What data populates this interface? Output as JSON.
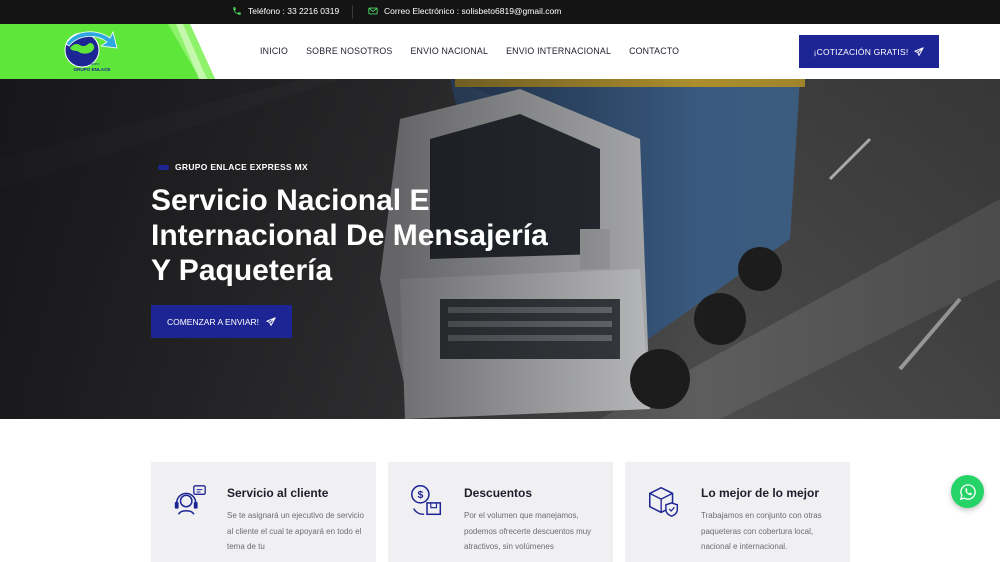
{
  "topbar": {
    "phone": "Teléfono : 33 2216 0319",
    "email": "Correo Electrónico : solisbeto6819@gmail.com"
  },
  "logo": {
    "text_top": "GRUPO",
    "text_bottom": "GRUPO ENLACE"
  },
  "nav": {
    "items": [
      "INICIO",
      "SOBRE NOSOTROS",
      "ENVIO NACIONAL",
      "ENVIO INTERNACIONAL",
      "CONTACTO"
    ],
    "quote_button": "¡COTIZACIÓN GRATIS!"
  },
  "hero": {
    "eyebrow": "GRUPO ENLACE EXPRESS MX",
    "title": "Servicio Nacional E Internacional De Mensajería Y Paquetería",
    "cta": "COMENZAR A ENVIAR!"
  },
  "cards": [
    {
      "title": "Servicio al cliente",
      "text": "Se te asignará un ejecutivo de servicio al cliente el cual te apoyará en todo el tema de tu"
    },
    {
      "title": "Descuentos",
      "text": "Por el volumen que manejamos, podemos ofrecerte descuentos muy atractivos, sin volúmenes"
    },
    {
      "title": "Lo mejor de lo mejor",
      "text": "Trabajamos en conjunto con otras paqueteras con cobertura local, nacional e internacional."
    }
  ],
  "colors": {
    "brand": "#1d2594",
    "accent_green": "#5ee63a",
    "whatsapp": "#25d366"
  }
}
